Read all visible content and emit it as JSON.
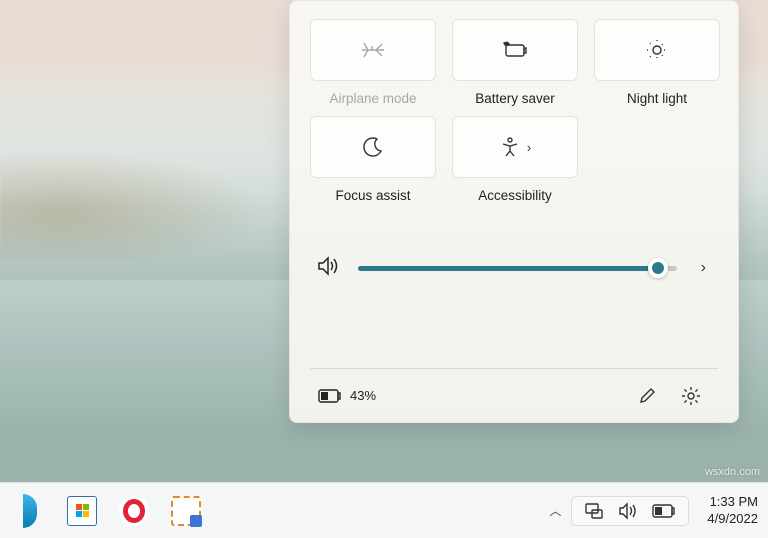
{
  "quick_settings": {
    "tiles": [
      {
        "key": "airplane",
        "label": "Airplane mode",
        "disabled": true
      },
      {
        "key": "battery_saver",
        "label": "Battery saver",
        "disabled": false
      },
      {
        "key": "night_light",
        "label": "Night light",
        "disabled": false
      },
      {
        "key": "focus_assist",
        "label": "Focus assist",
        "disabled": false
      },
      {
        "key": "accessibility",
        "label": "Accessibility",
        "disabled": false,
        "has_submenu": true
      }
    ],
    "volume": {
      "percent": 94
    },
    "battery": {
      "percent_label": "43%"
    }
  },
  "taskbar": {
    "clock": {
      "time": "1:33 PM",
      "date": "4/9/2022"
    }
  },
  "watermark": "wsxdn.com",
  "colors": {
    "accent": "#2b7a8c"
  }
}
